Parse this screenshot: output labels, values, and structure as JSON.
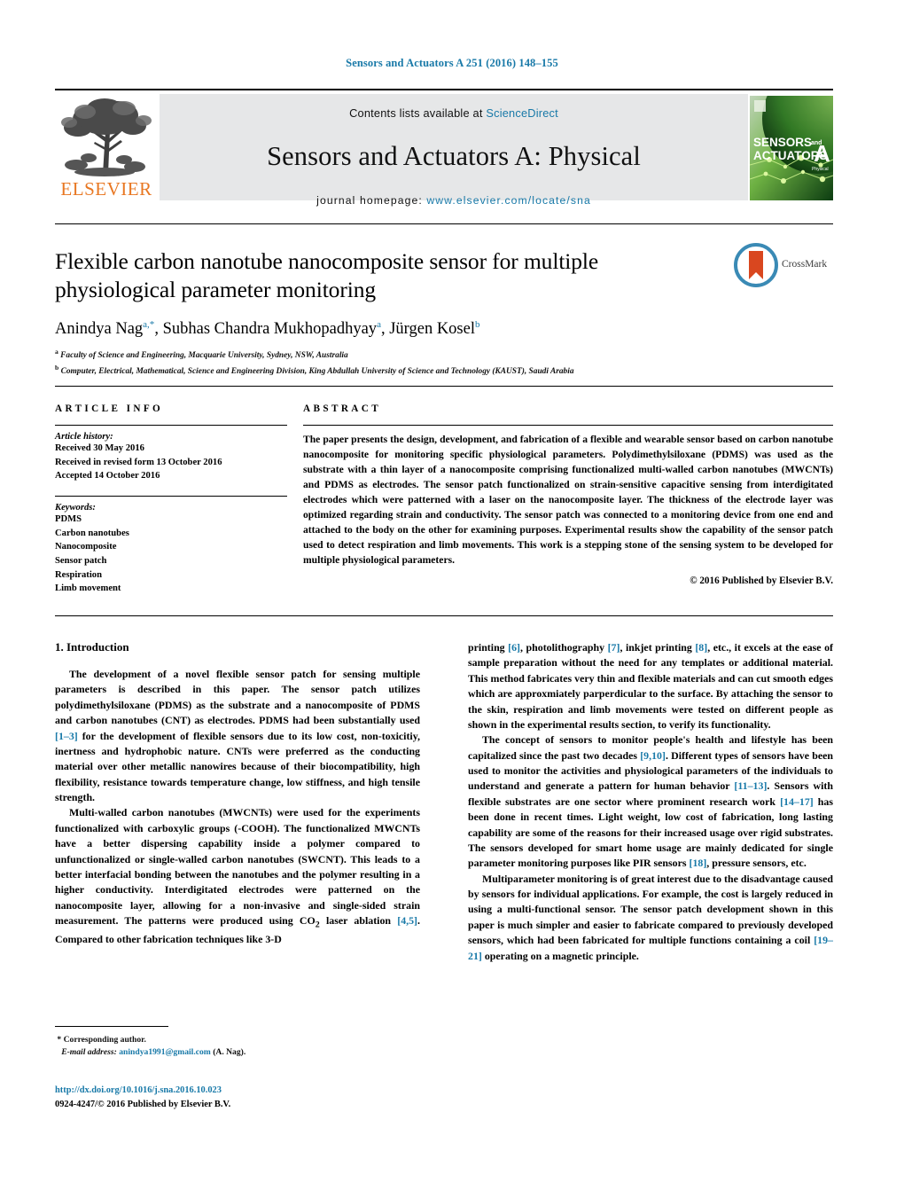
{
  "running_head": "Sensors and Actuators A 251 (2016) 148–155",
  "banner": {
    "contents_prefix": "Contents lists available at ",
    "sciencedirect": "ScienceDirect",
    "journal_title": "Sensors and Actuators A: Physical",
    "homepage_prefix": "journal homepage: ",
    "homepage_url": "www.elsevier.com/locate/sna",
    "publisher_wordmark": "ELSEVIER",
    "cover": {
      "line1": "SENSORS",
      "line1_small": "and",
      "line2": "ACTUATORS",
      "letter": "A",
      "sub": "Physical"
    }
  },
  "article": {
    "title": "Flexible carbon nanotube nanocomposite sensor for multiple physiological parameter monitoring",
    "crossmark_label": "CrossMark",
    "authors": [
      {
        "name": "Anindya Nag",
        "marks": "a,*"
      },
      {
        "name": "Subhas Chandra Mukhopadhyay",
        "marks": "a"
      },
      {
        "name": "Jürgen Kosel",
        "marks": "b"
      }
    ],
    "affiliations": [
      {
        "mark": "a",
        "text": "Faculty of Science and Engineering, Macquarie University, Sydney, NSW, Australia"
      },
      {
        "mark": "b",
        "text": "Computer, Electrical, Mathematical, Science and Engineering Division, King Abdullah University of Science and Technology (KAUST), Saudi Arabia"
      }
    ]
  },
  "article_info": {
    "heading": "ARTICLE INFO",
    "history_title": "Article history:",
    "history": [
      "Received 30 May 2016",
      "Received in revised form 13 October 2016",
      "Accepted 14 October 2016"
    ],
    "keywords_title": "Keywords:",
    "keywords": [
      "PDMS",
      "Carbon nanotubes",
      "Nanocomposite",
      "Sensor patch",
      "Respiration",
      "Limb movement"
    ]
  },
  "abstract": {
    "heading": "ABSTRACT",
    "text": "The paper presents the design, development, and fabrication of a flexible and wearable sensor based on carbon nanotube nanocomposite for monitoring specific physiological parameters. Polydimethylsiloxane (PDMS) was used as the substrate with a thin layer of a nanocomposite comprising functionalized multi-walled carbon nanotubes (MWCNTs) and PDMS as electrodes. The sensor patch functionalized on strain-sensitive capacitive sensing from interdigitated electrodes which were patterned with a laser on the nanocomposite layer. The thickness of the electrode layer was optimized regarding strain and conductivity. The sensor patch was connected to a monitoring device from one end and attached to the body on the other for examining purposes. Experimental results show the capability of the sensor patch used to detect respiration and limb movements. This work is a stepping stone of the sensing system to be developed for multiple physiological parameters.",
    "copyright": "© 2016 Published by Elsevier B.V."
  },
  "introduction": {
    "section_number": "1.",
    "section_title": "Introduction",
    "left_paragraphs": [
      {
        "parts": [
          {
            "t": "The development of a novel flexible sensor patch for sensing multiple parameters is described in this paper. The sensor patch utilizes polydimethylsiloxane (PDMS) as the substrate and a nanocomposite of PDMS and carbon nanotubes (CNT) as electrodes. PDMS had been substantially used ",
            "ref": false
          },
          {
            "t": "[1–3]",
            "ref": true
          },
          {
            "t": " for the development of flexible sensors due to its low cost, non-toxicitiy, inertness and hydrophobic nature. CNTs were preferred as the conducting material over other metallic nanowires because of their biocompatibility, high flexibility, resistance towards temperature change, low stiffness, and high tensile strength.",
            "ref": false
          }
        ]
      },
      {
        "parts": [
          {
            "t": "Multi-walled carbon nanotubes (MWCNTs) were used for the experiments functionalized with carboxylic groups (-COOH). The functionalized MWCNTs have a better dispersing capability inside a polymer compared to unfunctionalized or single-walled carbon nanotubes (SWCNT). This leads to a better interfacial bonding between the nanotubes and the polymer resulting in a higher conductivity. Interdigitated electrodes were patterned on the nanocomposite layer, allowing for a non-invasive and single-sided strain measurement. The patterns were produced using CO",
            "ref": false
          },
          {
            "t": "2",
            "sub": true
          },
          {
            "t": " laser ablation ",
            "ref": false
          },
          {
            "t": "[4,5]",
            "ref": true
          },
          {
            "t": ". Compared to other fabrication techniques like 3-D",
            "ref": false
          }
        ]
      }
    ],
    "right_paragraphs": [
      {
        "parts": [
          {
            "t": "printing ",
            "ref": false
          },
          {
            "t": "[6]",
            "ref": true
          },
          {
            "t": ", photolithography ",
            "ref": false
          },
          {
            "t": "[7]",
            "ref": true
          },
          {
            "t": ", inkjet printing ",
            "ref": false
          },
          {
            "t": "[8]",
            "ref": true
          },
          {
            "t": ", etc., it excels at the ease of sample preparation without the need for any templates or additional material. This method fabricates very thin and flexible materials and can cut smooth edges which are approxmiately parperdicular to the surface. By attaching the sensor to the skin, respiration and limb movements were tested on different people as shown in the experimental results section, to verify its functionality.",
            "ref": false
          }
        ],
        "indent": false
      },
      {
        "parts": [
          {
            "t": "The concept of sensors to monitor people's health and lifestyle has been capitalized since the past two decades ",
            "ref": false
          },
          {
            "t": "[9,10]",
            "ref": true
          },
          {
            "t": ". Different types of sensors have been used to monitor the activities and physiological parameters of the individuals to understand and generate a pattern for human behavior ",
            "ref": false
          },
          {
            "t": "[11–13]",
            "ref": true
          },
          {
            "t": ". Sensors with flexible substrates are one sector where prominent research work ",
            "ref": false
          },
          {
            "t": "[14–17]",
            "ref": true
          },
          {
            "t": " has been done in recent times. Light weight, low cost of fabrication, long lasting capability are some of the reasons for their increased usage over rigid substrates. The sensors developed for smart home usage are mainly dedicated for single parameter monitoring purposes like PIR sensors ",
            "ref": false
          },
          {
            "t": "[18]",
            "ref": true
          },
          {
            "t": ", pressure sensors, etc.",
            "ref": false
          }
        ],
        "indent": true
      },
      {
        "parts": [
          {
            "t": "Multiparameter monitoring is of great interest due to the disadvantage caused by sensors for individual applications. For example, the cost is largely reduced in using a multi-functional sensor. The sensor patch development shown in this paper is much simpler and easier to fabricate compared to previously developed sensors, which had been fabricated for multiple functions containing a coil ",
            "ref": false
          },
          {
            "t": "[19–21]",
            "ref": true
          },
          {
            "t": " operating on a magnetic principle.",
            "ref": false
          }
        ],
        "indent": true
      }
    ]
  },
  "footer": {
    "corresponding_marker": "*",
    "corresponding_label": "Corresponding author.",
    "email_label": "E-mail address:",
    "email": "anindya1991@gmail.com",
    "email_suffix": "(A. Nag).",
    "doi": "http://dx.doi.org/10.1016/j.sna.2016.10.023",
    "issn_line": "0924-4247/© 2016 Published by Elsevier B.V."
  },
  "colors": {
    "link": "#1879a8",
    "elsevier_orange": "#e87722",
    "banner_gray": "#e6e7e8"
  }
}
